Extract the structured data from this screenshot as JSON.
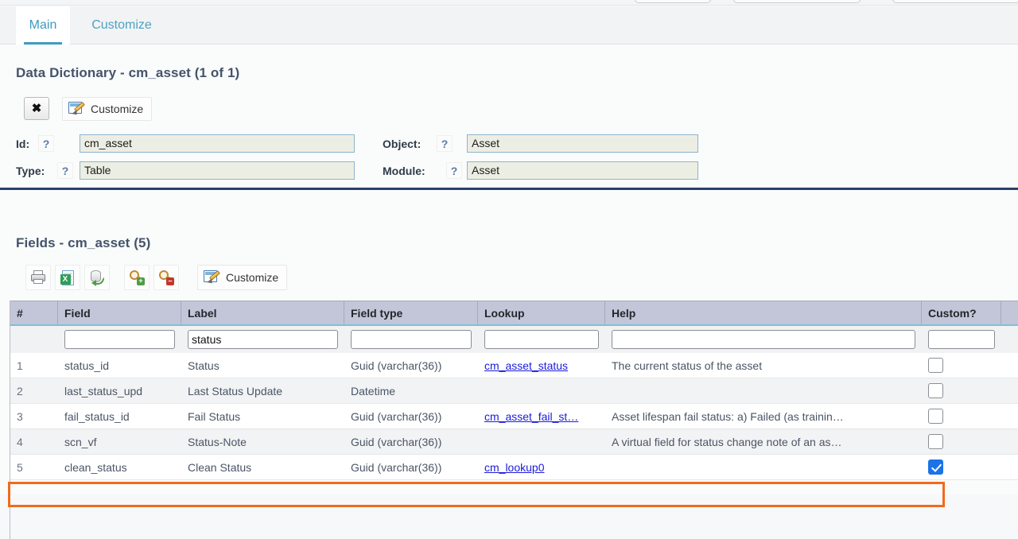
{
  "tabs": [
    {
      "label": "Main",
      "active": true
    },
    {
      "label": "Customize",
      "active": false
    }
  ],
  "record_section": {
    "title": "Data Dictionary - cm_asset (1 of 1)",
    "toolbar": {
      "close_icon": "close-x-icon",
      "customize_label": "Customize",
      "customize_icon": "customize-icon"
    },
    "fields": [
      {
        "label": "Id:",
        "help_icon": "?",
        "value": "cm_asset"
      },
      {
        "label": "Type:",
        "help_icon": "?",
        "value": "Table"
      },
      {
        "label": "Object:",
        "help_icon": "?",
        "value": "Asset"
      },
      {
        "label": "Module:",
        "help_icon": "?",
        "value": "Asset"
      }
    ]
  },
  "fields_section": {
    "title": "Fields - cm_asset (5)",
    "toolbar": {
      "print_icon": "printer-icon",
      "export_icon": "excel-export-icon",
      "refresh_icon": "database-refresh-icon",
      "zoom_in_icon": "magnifier-plus-icon",
      "zoom_out_icon": "magnifier-minus-icon",
      "customize_label": "Customize",
      "customize_icon": "customize-icon"
    },
    "columns": [
      {
        "key": "num",
        "label": "#"
      },
      {
        "key": "field",
        "label": "Field"
      },
      {
        "key": "flabel",
        "label": "Label"
      },
      {
        "key": "ftype",
        "label": "Field type"
      },
      {
        "key": "lookup",
        "label": "Lookup"
      },
      {
        "key": "help",
        "label": "Help"
      },
      {
        "key": "custom",
        "label": "Custom?"
      }
    ],
    "filters": {
      "num": "",
      "field": "",
      "flabel": "status",
      "ftype": "",
      "lookup": "",
      "help": "",
      "custom": ""
    },
    "rows": [
      {
        "num": "1",
        "field": "status_id",
        "flabel": "Status",
        "ftype": "Guid (varchar(36))",
        "lookup": "cm_asset_status",
        "help": "The current status of the asset",
        "custom": false,
        "highlighted": false
      },
      {
        "num": "2",
        "field": "last_status_upd",
        "flabel": "Last Status Update",
        "ftype": "Datetime",
        "lookup": "",
        "help": "",
        "custom": false,
        "highlighted": false
      },
      {
        "num": "3",
        "field": "fail_status_id",
        "flabel": "Fail Status",
        "ftype": "Guid (varchar(36))",
        "lookup": "cm_asset_fail_st…",
        "help": "Asset lifespan fail status: a) Failed (as trainin…",
        "custom": false,
        "highlighted": false
      },
      {
        "num": "4",
        "field": "scn_vf",
        "flabel": "Status-Note",
        "ftype": "Guid (varchar(36))",
        "lookup": "",
        "help": "A virtual field for status change note of an as…",
        "custom": false,
        "highlighted": true
      },
      {
        "num": "5",
        "field": "clean_status",
        "flabel": "Clean Status",
        "ftype": "Guid (varchar(36))",
        "lookup": "cm_lookup0",
        "help": "",
        "custom": true,
        "highlighted": false
      }
    ]
  },
  "colors": {
    "accent_tab": "#3f9cc0",
    "divider_navy": "#2b3f6b",
    "highlight_orange": "#f26a1b",
    "link_blue": "#1b1bdd",
    "header_lavender": "#c3c6d8",
    "checkbox_on": "#1a73e8"
  }
}
